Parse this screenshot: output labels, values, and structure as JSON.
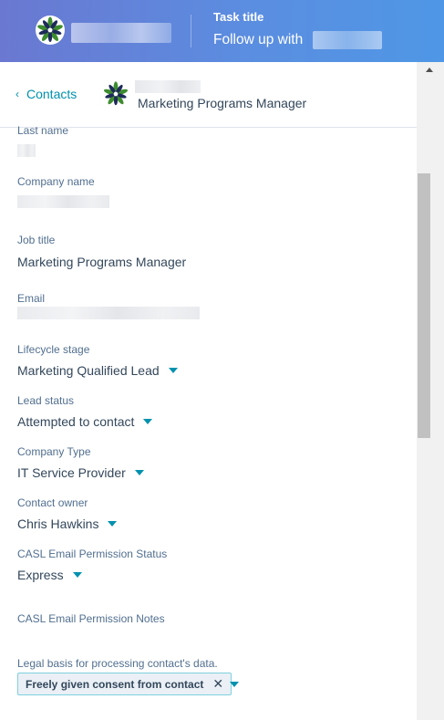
{
  "header": {
    "task_label": "Task title",
    "task_value": "Follow up with"
  },
  "subheader": {
    "back_label": "Contacts",
    "contact_title": "Marketing Programs Manager"
  },
  "fields": {
    "last_name_label": "Last name",
    "company_name_label": "Company name",
    "job_title_label": "Job title",
    "job_title_value": "Marketing Programs Manager",
    "email_label": "Email",
    "lifecycle_label": "Lifecycle stage",
    "lifecycle_value": "Marketing Qualified Lead",
    "lead_status_label": "Lead status",
    "lead_status_value": "Attempted to contact",
    "company_type_label": "Company Type",
    "company_type_value": "IT Service Provider",
    "owner_label": "Contact owner",
    "owner_value": "Chris Hawkins",
    "casl_status_label": "CASL Email Permission Status",
    "casl_status_value": "Express",
    "casl_notes_label": "CASL Email Permission Notes",
    "legal_basis_label": "Legal basis for processing contact's data.",
    "legal_basis_tag": "Freely given consent from contact",
    "legal_basis_remove": "✕"
  },
  "icons": {
    "logo": "company-logo-icon",
    "back": "chevron-left-icon",
    "dropdown": "caret-down-icon"
  },
  "colors": {
    "header_start": "#6a78d1",
    "header_end": "#4f97e6",
    "accent": "#0091ae",
    "logo_green": "#3d8c2f",
    "logo_navy": "#1e2a5a"
  }
}
